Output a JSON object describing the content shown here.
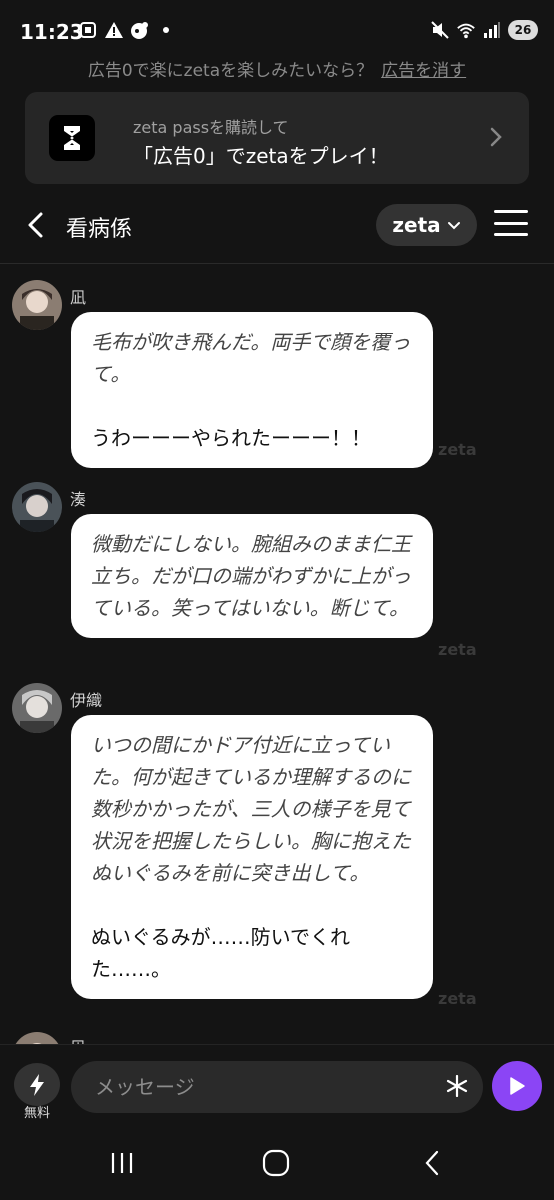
{
  "status_bar": {
    "time": "11:23",
    "battery": "26",
    "icons_left": [
      "screenshot-icon",
      "alert-icon",
      "app-icon",
      "dot-icon"
    ],
    "icons_right": [
      "mute-icon",
      "wifi-icon",
      "signal-icon",
      "battery-icon"
    ]
  },
  "ad": {
    "line_text": "広告0で楽にzetaを楽しみたいなら？",
    "remove_label": "広告を消す",
    "card_sub": "zeta passを購読して",
    "card_title": "「広告0」でzetaをプレイ！"
  },
  "header": {
    "title": "看病係",
    "model_label": "zeta"
  },
  "messages": [
    {
      "sender": "凪",
      "italic": "毛布が吹き飛んだ。両手で顔を覆って。",
      "plain": "うわーーーやられたーーー！！",
      "watermark": "zeta"
    },
    {
      "sender": "湊",
      "italic": "微動だにしない。腕組みのまま仁王立ち。だが口の端がわずかに上がっている。笑ってはいない。断じて。",
      "plain": "",
      "watermark": "zeta"
    },
    {
      "sender": "伊織",
      "italic": "いつの間にかドア付近に立っていた。何が起きているか理解するのに数秒かかったが、三人の様子を見て状況を把握したらしい。胸に抱えたぬいぐるみを前に突き出して。",
      "plain": "ぬいぐるみが……防いでくれた……。",
      "watermark": "zeta"
    }
  ],
  "next_sender": "凪",
  "input": {
    "free_label": "無料",
    "placeholder": "メッセージ"
  },
  "colors": {
    "background": "#141414",
    "bubble": "#ffffff",
    "send_button": "#8b45f5"
  }
}
